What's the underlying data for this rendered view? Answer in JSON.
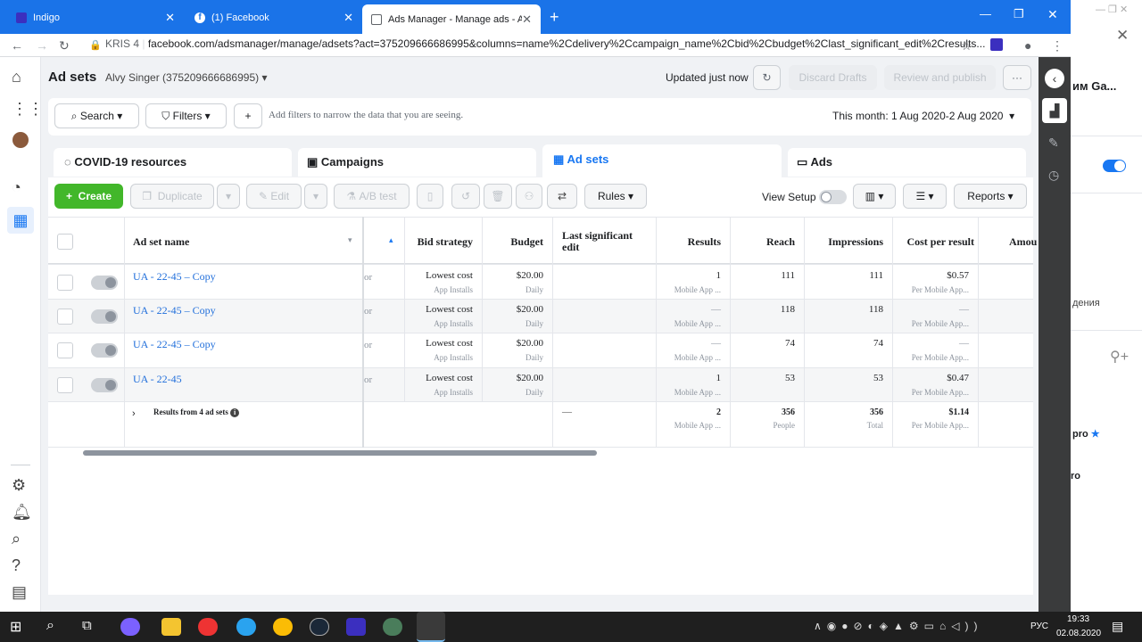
{
  "browser": {
    "tabs": [
      {
        "label": "Indigo",
        "active": false
      },
      {
        "label": "(1) Facebook",
        "active": false
      },
      {
        "label": "Ads Manager - Manage ads - Ad",
        "active": true
      }
    ],
    "profile": "KRIS 4",
    "url": "facebook.com/adsmanager/manage/adsets?act=375209666686995&columns=name%2Cdelivery%2Ccampaign_name%2Cbid%2Cbudget%2Clast_significant_edit%2Cresults..."
  },
  "header": {
    "title": "Ad sets",
    "account": "Alvy Singer (375209666686995)",
    "updated": "Updated just now",
    "discard": "Discard Drafts",
    "review": "Review and publish",
    "more": "···"
  },
  "filterbar": {
    "search": "Search",
    "filters": "Filters",
    "placeholder": "Add filters to narrow the data that you are seeing.",
    "daterange": "This month: 1 Aug 2020-2 Aug 2020"
  },
  "levels": {
    "covid": "COVID-19 resources",
    "campaigns": "Campaigns",
    "adsets": "Ad sets",
    "ads": "Ads"
  },
  "toolbar": {
    "create": "Create",
    "duplicate": "Duplicate",
    "edit": "Edit",
    "abtest": "A/B test",
    "rules": "Rules",
    "viewsetup": "View Setup",
    "reports": "Reports"
  },
  "table": {
    "headers": {
      "name": "Ad set name",
      "bid": "Bid strategy",
      "budget": "Budget",
      "lastedit": "Last significant edit",
      "results": "Results",
      "reach": "Reach",
      "impressions": "Impressions",
      "cpr": "Cost per result",
      "amount": "Amou"
    },
    "rows": [
      {
        "name": "UA - 22-45 – Copy",
        "trunc": "or",
        "bid": "Lowest cost",
        "bid_sub": "App Installs",
        "budget": "$20.00",
        "budget_sub": "Daily",
        "results": "1",
        "results_sub": "Mobile App ...",
        "reach": "111",
        "impressions": "111",
        "cpr": "$0.57",
        "cpr_sub": "Per Mobile App..."
      },
      {
        "name": "UA - 22-45 – Copy",
        "trunc": "or",
        "bid": "Lowest cost",
        "bid_sub": "App Installs",
        "budget": "$20.00",
        "budget_sub": "Daily",
        "results": "—",
        "results_sub": "Mobile App ...",
        "reach": "118",
        "impressions": "118",
        "cpr": "—",
        "cpr_sub": "Per Mobile App..."
      },
      {
        "name": "UA - 22-45 – Copy",
        "trunc": "or",
        "bid": "Lowest cost",
        "bid_sub": "App Installs",
        "budget": "$20.00",
        "budget_sub": "Daily",
        "results": "—",
        "results_sub": "Mobile App ...",
        "reach": "74",
        "impressions": "74",
        "cpr": "—",
        "cpr_sub": "Per Mobile App..."
      },
      {
        "name": "UA - 22-45",
        "trunc": "or",
        "bid": "Lowest cost",
        "bid_sub": "App Installs",
        "budget": "$20.00",
        "budget_sub": "Daily",
        "results": "1",
        "results_sub": "Mobile App ...",
        "reach": "53",
        "impressions": "53",
        "cpr": "$0.47",
        "cpr_sub": "Per Mobile App..."
      }
    ],
    "summary": {
      "label": "Results from 4 ad sets",
      "lastedit": "—",
      "results": "2",
      "results_sub": "Mobile App ...",
      "reach": "356",
      "reach_sub": "People",
      "impressions": "356",
      "impressions_sub": "Total",
      "cpr": "$1.14",
      "cpr_sub": "Per Mobile App..."
    }
  },
  "rightwin": {
    "text1": "им Ga...",
    "text2": "дения",
    "text3": "pro",
    "text4": "ro"
  },
  "taskbar": {
    "lang": "РУС",
    "time": "19:33",
    "date": "02.08.2020"
  }
}
